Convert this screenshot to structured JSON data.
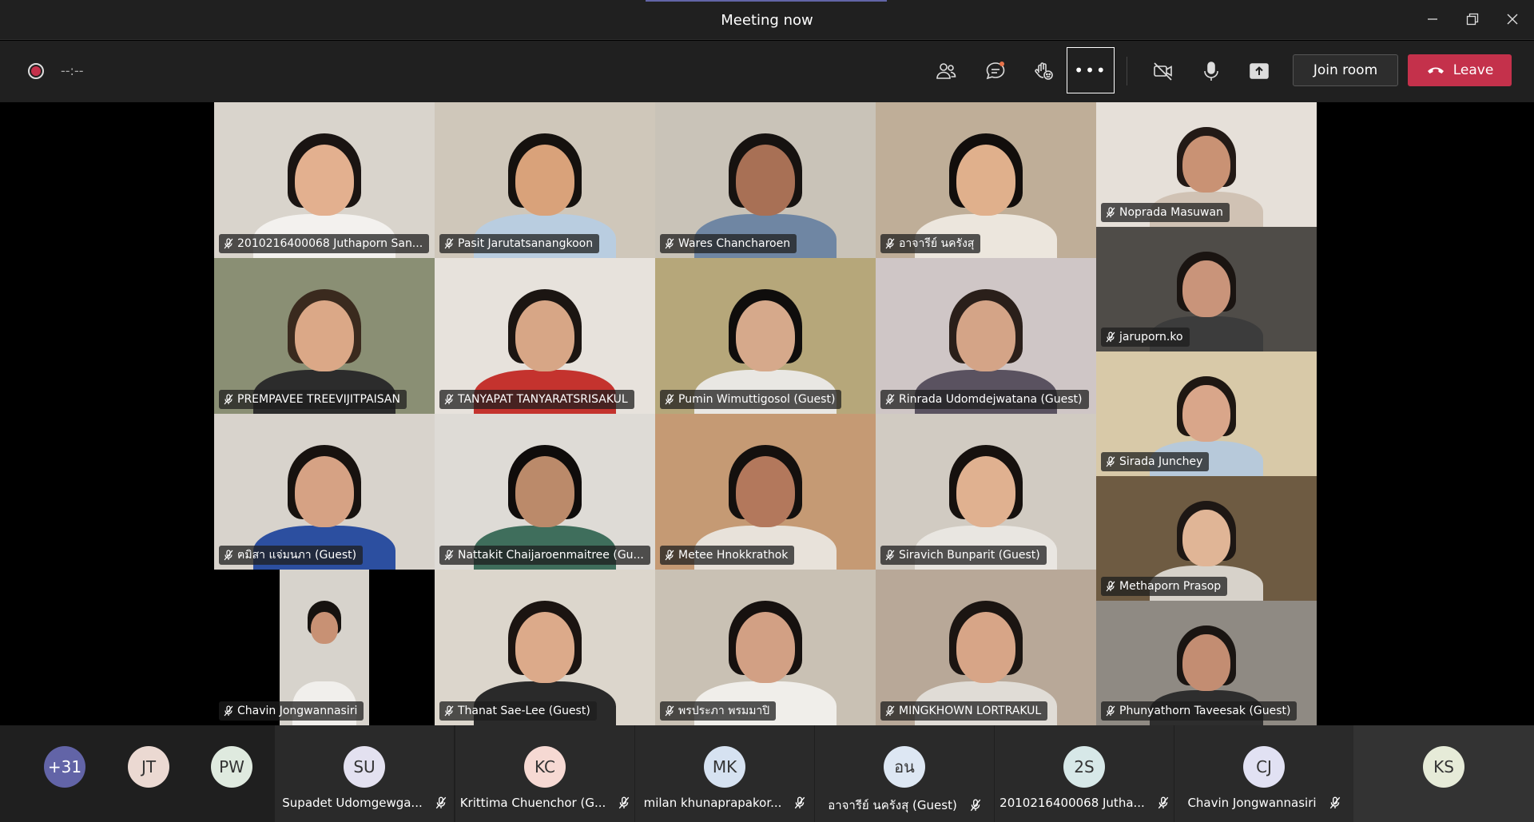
{
  "window": {
    "title": "Meeting now"
  },
  "toolbar": {
    "timer": "--:--",
    "more_label": "•••",
    "join_label": "Join room",
    "leave_label": "Leave"
  },
  "tiles": [
    {
      "name": "2010216400068 Juthaporn  San...",
      "bg": "#d9d4cc",
      "skin": "#e3b08f",
      "hair": "#1a1412",
      "shirt": "#f3f1ee"
    },
    {
      "name": "Pasit Jarutatsanangkoon",
      "bg": "#cfc7ba",
      "skin": "#d9a27a",
      "hair": "#15110e",
      "shirt": "#b9cde0"
    },
    {
      "name": "Wares Chancharoen",
      "bg": "#c9c3b8",
      "skin": "#a87055",
      "hair": "#161210",
      "shirt": "#6f86a3"
    },
    {
      "name": "อาจารีย์ นครังสุ",
      "bg": "#bfae98",
      "skin": "#e0b08c",
      "hair": "#120e0c",
      "shirt": "#ece6dd"
    },
    {
      "name": "Noprada Masuwan",
      "bg": "#e6e0d9",
      "skin": "#c99274",
      "hair": "#231a16",
      "shirt": "#d0c2b4"
    },
    {
      "name": "PREMPAVEE TREEVIJITPAISAN",
      "bg": "#8a8f74",
      "skin": "#dba887",
      "hair": "#3a2a1e",
      "shirt": "#2c2c2c"
    },
    {
      "name": "TANYAPAT TANYARATSRISAKUL",
      "bg": "#e7e2dc",
      "skin": "#d7a686",
      "hair": "#1b1512",
      "shirt": "#c4332e"
    },
    {
      "name": "Pumin Wimuttigosol (Guest)",
      "bg": "#b6a77a",
      "skin": "#d6a98b",
      "hair": "#0f0d0c",
      "shirt": "#e9e7e3"
    },
    {
      "name": "Rinrada Udomdejwatana (Guest)",
      "bg": "#cfc6c6",
      "skin": "#d4a487",
      "hair": "#2a1f1a",
      "shirt": "#5a5260"
    },
    {
      "name": "jaruporn.ko",
      "bg": "#4f4c48",
      "skin": "#c9947a",
      "hair": "#1a1411",
      "shirt": "#3c3c3c"
    },
    {
      "name": "ฅมิสา แจ่มนภา (Guest)",
      "bg": "#d8d3cc",
      "skin": "#d6a284",
      "hair": "#17120f",
      "shirt": "#2c4fa0"
    },
    {
      "name": "Nattakit Chaijaroenmaitree (Gu...",
      "bg": "#dedbd6",
      "skin": "#bb8a6a",
      "hair": "#0f0c0b",
      "shirt": "#3f6e5c"
    },
    {
      "name": "Metee Hnokkrathok",
      "bg": "#c59a74",
      "skin": "#b3785c",
      "hair": "#14100e",
      "shirt": "#e8e2da"
    },
    {
      "name": "Siravich Bunparit (Guest)",
      "bg": "#d1cbc2",
      "skin": "#e0b190",
      "hair": "#16110e",
      "shirt": "#e9e6e1"
    },
    {
      "name": "Sirada Junchey",
      "bg": "#d8c9a8",
      "skin": "#d9a68a",
      "hair": "#1e1712",
      "shirt": "#b7c9da"
    },
    {
      "name": "Methaporn Prasop",
      "bg": "#6e5b42",
      "skin": "#e0b596",
      "hair": "#1d1714",
      "shirt": "#d7d2ca"
    },
    {
      "name": "Chavin Jongwannasiri",
      "bg": "#d7d3cc",
      "skin": "#c89174",
      "hair": "#16120f",
      "shirt": "#f1efec"
    },
    {
      "name": "Thanat Sae-Lee (Guest)",
      "bg": "#dcd6cc",
      "skin": "#dcaa8a",
      "hair": "#1b1411",
      "shirt": "#2a2a2a"
    },
    {
      "name": "พรประภา พรมมาปิ",
      "bg": "#c9c1b4",
      "skin": "#d2a084",
      "hair": "#16110f",
      "shirt": "#f0eeea"
    },
    {
      "name": "MINGKHOWN LORTRAKUL",
      "bg": "#b8a898",
      "skin": "#d7a587",
      "hair": "#1b1512",
      "shirt": "#e0dcd6"
    },
    {
      "name": "Phunyathorn Taveesak (Guest)",
      "bg": "#8f8a83",
      "skin": "#c38d72",
      "hair": "#1a1512",
      "shirt": "#2e2e2e"
    }
  ],
  "bottom": {
    "overflow": {
      "initials": "+31",
      "color": "#6264a7"
    },
    "participants": [
      {
        "initials": "JT",
        "color": "#ebd9d2",
        "name": ""
      },
      {
        "initials": "PW",
        "color": "#dfeadf",
        "name": ""
      },
      {
        "initials": "SU",
        "color": "#e3e1f0",
        "name": "Supadet Udomgewga..."
      },
      {
        "initials": "KC",
        "color": "#f6d9d3",
        "name": "Krittima Chuenchor (G..."
      },
      {
        "initials": "MK",
        "color": "#d6e2f1",
        "name": "milan khunaprapakor..."
      },
      {
        "initials": "อน",
        "color": "#dde7f3",
        "name": "อาจารีย์ นครังสุ (Guest)"
      },
      {
        "initials": "2S",
        "color": "#d7e8e8",
        "name": "2010216400068 Jutha..."
      },
      {
        "initials": "CJ",
        "color": "#e1e1f3",
        "name": "Chavin Jongwannasiri"
      },
      {
        "initials": "KS",
        "color": "#e6ebd8",
        "name": ""
      }
    ]
  }
}
